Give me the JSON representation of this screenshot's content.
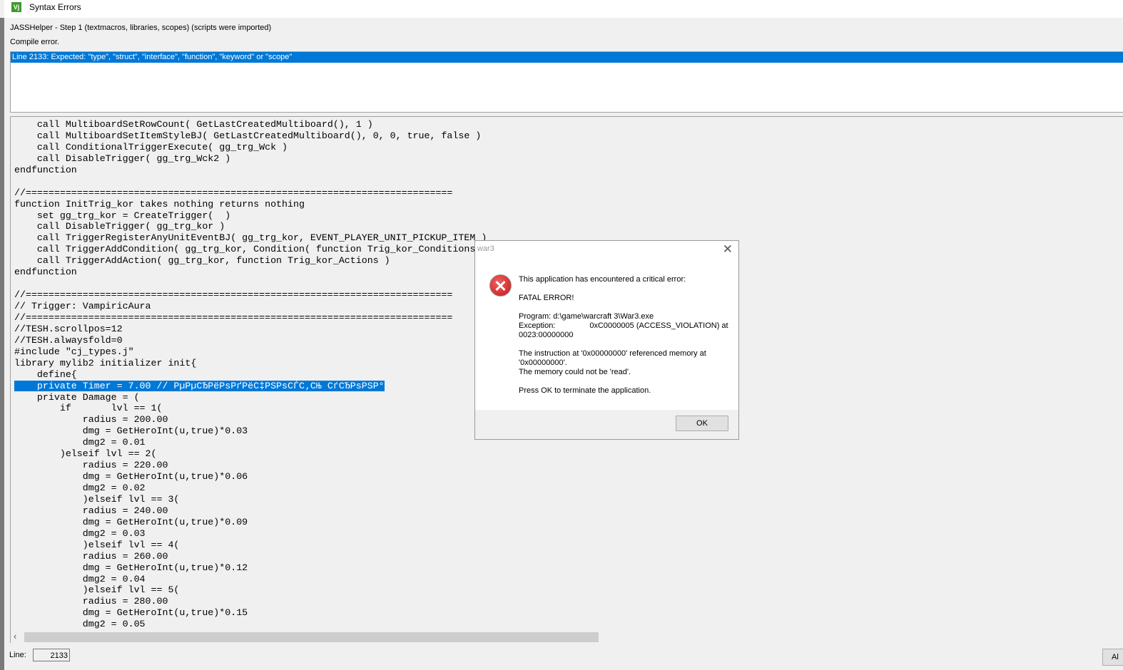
{
  "window": {
    "title": "Syntax Errors",
    "icon_text": "Vj"
  },
  "status": {
    "step": "JASSHelper - Step 1 (textmacros, libraries, scopes) (scripts were imported)",
    "result": "Compile error."
  },
  "errors": [
    "Line 2133: Expected: \"type\", \"struct\", \"interface\", \"function\", \"keyword\" or \"scope\""
  ],
  "code_lines": [
    "    call MultiboardSetRowCount( GetLastCreatedMultiboard(), 1 )",
    "    call MultiboardSetItemStyleBJ( GetLastCreatedMultiboard(), 0, 0, true, false )",
    "    call ConditionalTriggerExecute( gg_trg_Wck )",
    "    call DisableTrigger( gg_trg_Wck2 )",
    "endfunction",
    "",
    "//===========================================================================",
    "function InitTrig_kor takes nothing returns nothing",
    "    set gg_trg_kor = CreateTrigger(  )",
    "    call DisableTrigger( gg_trg_kor )",
    "    call TriggerRegisterAnyUnitEventBJ( gg_trg_kor, EVENT_PLAYER_UNIT_PICKUP_ITEM )",
    "    call TriggerAddCondition( gg_trg_kor, Condition( function Trig_kor_Conditions ) )",
    "    call TriggerAddAction( gg_trg_kor, function Trig_kor_Actions )",
    "endfunction",
    "",
    "//===========================================================================",
    "// Trigger: VampiricAura",
    "//===========================================================================",
    "//TESH.scrollpos=12",
    "//TESH.alwaysfold=0",
    "#include \"cj_types.j\"",
    "library mylib2 initializer init{",
    "    define{",
    "    private Timer = 7.00 // РµРµСЂРёРѕРґРёС‡РЅРѕСЃС‚СЊ СѓСЂРѕРЅР°",
    "    private Damage = (",
    "        if       lvl == 1(",
    "            radius = 200.00",
    "            dmg = GetHeroInt(u,true)*0.03",
    "            dmg2 = 0.01",
    "        )elseif lvl == 2(",
    "            radius = 220.00",
    "            dmg = GetHeroInt(u,true)*0.06",
    "            dmg2 = 0.02",
    "            )elseif lvl == 3(",
    "            radius = 240.00",
    "            dmg = GetHeroInt(u,true)*0.09",
    "            dmg2 = 0.03",
    "            )elseif lvl == 4(",
    "            radius = 260.00",
    "            dmg = GetHeroInt(u,true)*0.12",
    "            dmg2 = 0.04",
    "            )elseif lvl == 5(",
    "            radius = 280.00",
    "            dmg = GetHeroInt(u,true)*0.15",
    "            dmg2 = 0.05"
  ],
  "highlighted_line_index": 23,
  "footer": {
    "line_label": "Line:",
    "line_value": "2133",
    "right_button": "Al"
  },
  "dialog": {
    "title": "war3",
    "close": "✕",
    "icon": "✕",
    "line1": "This application has encountered a critical error:",
    "line2": "FATAL ERROR!",
    "program": "Program: d:\\game\\warcraft 3\\War3.exe",
    "exception_label": "Exception:",
    "exception_value": "0xC0000005 (ACCESS_VIOLATION) at",
    "exception_addr": "0023:00000000",
    "instr": "The instruction at '0x00000000' referenced memory at '0x00000000'.",
    "read": "The memory could not be 'read'.",
    "press": "Press OK to terminate the application.",
    "ok": "OK"
  }
}
